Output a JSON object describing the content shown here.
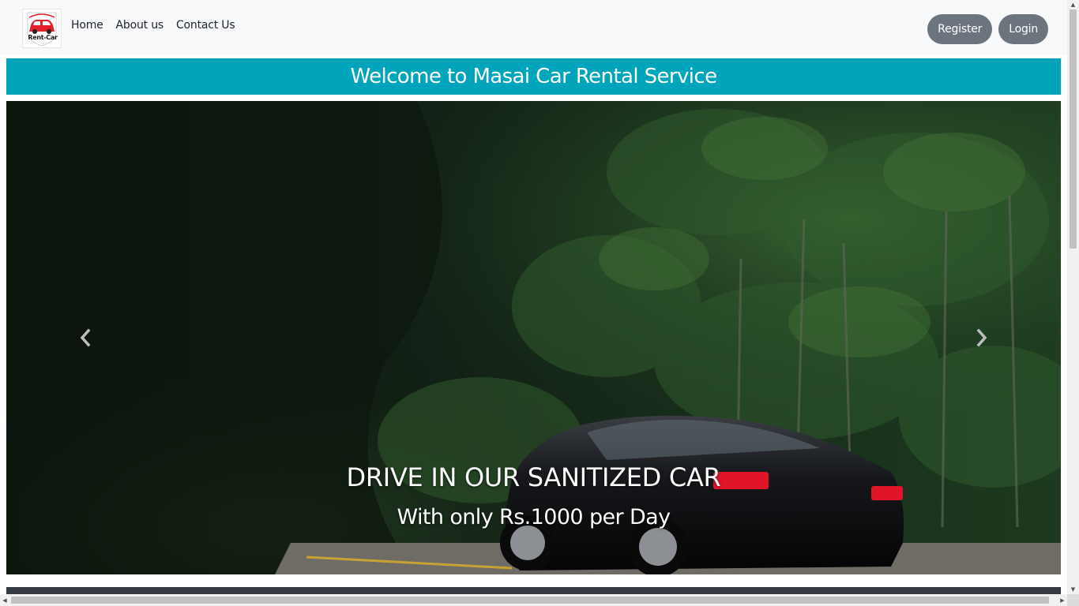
{
  "navbar": {
    "logo": {
      "text": "Rent-Car",
      "icon": "red-car-logo-icon"
    },
    "links": [
      "Home",
      "About us",
      "Contact Us"
    ],
    "register_label": "Register",
    "login_label": "Login"
  },
  "banner": {
    "title": "Welcome to Masai Car Rental Service"
  },
  "carousel": {
    "caption_title": "DRIVE IN OUR SANITIZED CAR",
    "caption_subtitle": "With only Rs.1000 per Day",
    "prev_icon": "chevron-left-icon",
    "next_icon": "chevron-right-icon",
    "slide_image": "black car on forest road"
  },
  "colors": {
    "navbar_bg": "#f8f9fa",
    "banner_bg": "#00a5bb",
    "button_bg": "#6c757d",
    "footer_strip": "#343a40"
  }
}
